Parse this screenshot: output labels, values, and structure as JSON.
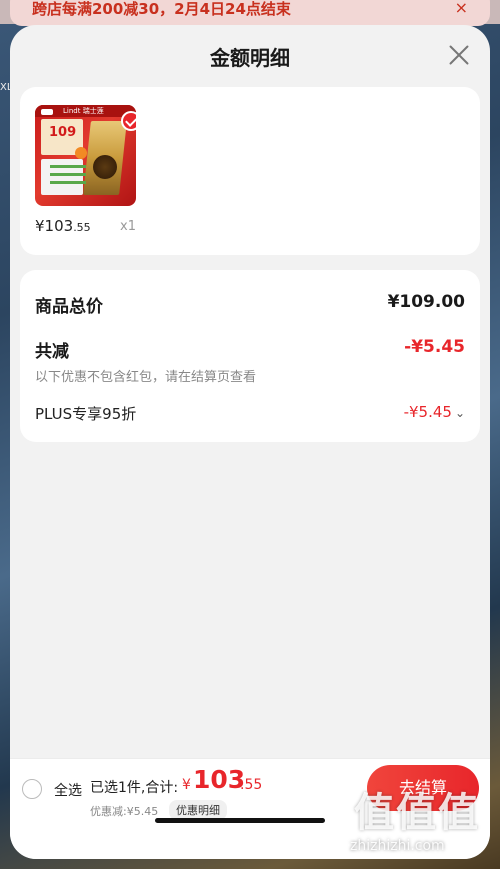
{
  "promo": {
    "text": "跨店每满200减30，2月4日24点结束",
    "close": "×"
  },
  "side_text": "XL",
  "sheet": {
    "title": "金额明细",
    "close_icon": "close-icon"
  },
  "item": {
    "thumbnail_price": "109",
    "thumbnail_brand": "Lindt 瑞士莲",
    "price_main": "¥103",
    "price_decimal": ".55",
    "quantity": "x1",
    "selected": true
  },
  "price_breakdown": {
    "subtotal_label": "商品总价",
    "subtotal_value": "¥109.00",
    "discount_label": "共减",
    "discount_value": "-¥5.45",
    "discount_note": "以下优惠不包含红包，请在结算页查看",
    "plus_label": "PLUS专享95折",
    "plus_value": "-¥5.45"
  },
  "bottom_bar": {
    "select_all_label": "全选",
    "selected_text": "已选1件,合计:",
    "total_currency": "¥",
    "total_main": "103",
    "total_decimal": ".55",
    "discount_text": "优惠减:¥5.45",
    "discount_detail": "优惠明细",
    "checkout_label": "去结算"
  },
  "watermark": {
    "logo": "值值值",
    "url": "zhizhizhi.com"
  },
  "colors": {
    "accent": "#e8262b",
    "sheet_bg": "#f2f2f2",
    "card_bg": "#ffffff"
  }
}
